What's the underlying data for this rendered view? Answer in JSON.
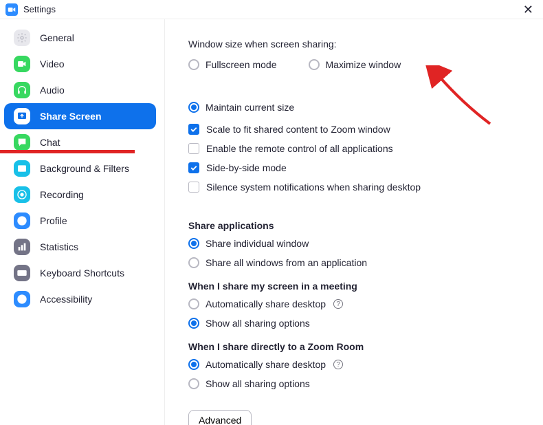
{
  "window": {
    "title": "Settings"
  },
  "sidebar": {
    "items": [
      {
        "id": "general",
        "label": "General",
        "iconBg": "#E8E8ED",
        "icon": "gear",
        "iconColor": "#B8B8C2"
      },
      {
        "id": "video",
        "label": "Video",
        "iconBg": "#37D860",
        "icon": "camera",
        "iconColor": "#fff"
      },
      {
        "id": "audio",
        "label": "Audio",
        "iconBg": "#37D860",
        "icon": "headphones",
        "iconColor": "#fff"
      },
      {
        "id": "share",
        "label": "Share Screen",
        "iconBg": "#fff",
        "icon": "share",
        "iconColor": "#0E71EB",
        "active": true
      },
      {
        "id": "chat",
        "label": "Chat",
        "iconBg": "#37D860",
        "icon": "chat",
        "iconColor": "#fff"
      },
      {
        "id": "bg",
        "label": "Background & Filters",
        "iconBg": "#18C0E8",
        "icon": "bg",
        "iconColor": "#fff"
      },
      {
        "id": "recording",
        "label": "Recording",
        "iconBg": "#18C0E8",
        "icon": "record",
        "iconColor": "#fff"
      },
      {
        "id": "profile",
        "label": "Profile",
        "iconBg": "#2D8CFF",
        "icon": "profile",
        "iconColor": "#fff"
      },
      {
        "id": "stats",
        "label": "Statistics",
        "iconBg": "#747487",
        "icon": "stats",
        "iconColor": "#fff"
      },
      {
        "id": "keyboard",
        "label": "Keyboard Shortcuts",
        "iconBg": "#747487",
        "icon": "keyboard",
        "iconColor": "#fff"
      },
      {
        "id": "accessibility",
        "label": "Accessibility",
        "iconBg": "#2D8CFF",
        "icon": "accessibility",
        "iconColor": "#fff"
      }
    ]
  },
  "content": {
    "windowSizeLabel": "Window size when screen sharing:",
    "windowSizeOptions": [
      {
        "id": "fullscreen",
        "label": "Fullscreen mode"
      },
      {
        "id": "maximize",
        "label": "Maximize window"
      },
      {
        "id": "maintain",
        "label": "Maintain current size",
        "selected": true
      }
    ],
    "checks": [
      {
        "id": "scale",
        "label": "Scale to fit shared content to Zoom window",
        "checked": true
      },
      {
        "id": "remote",
        "label": "Enable the remote control of all applications",
        "checked": false
      },
      {
        "id": "sidebyside",
        "label": "Side-by-side mode",
        "checked": true
      },
      {
        "id": "silence",
        "label": "Silence system notifications when sharing desktop",
        "checked": false
      }
    ],
    "groups": [
      {
        "title": "Share applications",
        "options": [
          {
            "id": "indiv",
            "label": "Share individual window",
            "selected": true
          },
          {
            "id": "allwin",
            "label": "Share all windows from an application"
          }
        ]
      },
      {
        "title": "When I share my screen in a meeting",
        "options": [
          {
            "id": "autoshare1",
            "label": "Automatically share desktop",
            "help": true
          },
          {
            "id": "showall1",
            "label": "Show all sharing options",
            "selected": true
          }
        ]
      },
      {
        "title": "When I share directly to a Zoom Room",
        "options": [
          {
            "id": "autoshare2",
            "label": "Automatically share desktop",
            "help": true,
            "selected": true
          },
          {
            "id": "showall2",
            "label": "Show all sharing options"
          }
        ]
      }
    ],
    "advancedLabel": "Advanced"
  }
}
